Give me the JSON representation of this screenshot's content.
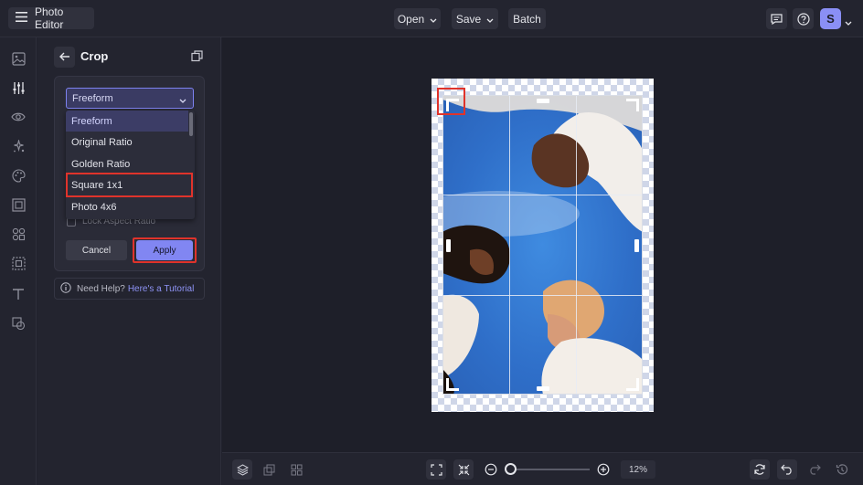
{
  "app": {
    "title": "Photo Editor"
  },
  "toolbar": {
    "open_label": "Open",
    "save_label": "Save",
    "batch_label": "Batch"
  },
  "user": {
    "avatar_initial": "S"
  },
  "left_nav": [
    "image-icon",
    "sliders-icon",
    "eye-icon",
    "effects-icon",
    "palette-icon",
    "frame-icon",
    "shapes-icon",
    "texture-icon",
    "text-icon",
    "overlay-icon"
  ],
  "panel": {
    "title": "Crop",
    "select_value": "Freeform",
    "options": [
      "Freeform",
      "Original Ratio",
      "Golden Ratio",
      "Square 1x1",
      "Photo 4x6"
    ],
    "selected_option": "Freeform",
    "highlighted_option": "Square 1x1",
    "lock_label": "Lock Aspect Ratio",
    "cancel_label": "Cancel",
    "apply_label": "Apply",
    "help_text": "Need Help?",
    "help_link": "Here's a Tutorial"
  },
  "bottom": {
    "zoom_value": "12%"
  },
  "colors": {
    "accent": "#8186f2",
    "highlight": "#e0332b",
    "background": "#21222d"
  }
}
